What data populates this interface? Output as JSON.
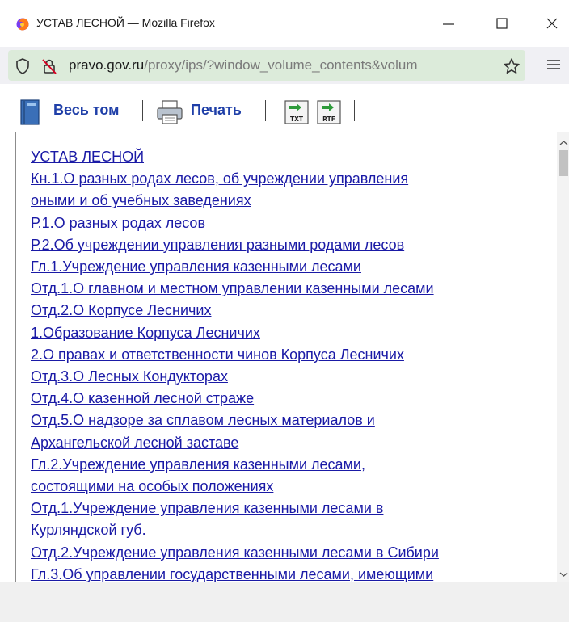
{
  "window": {
    "title": "УСТАВ ЛЕСНОЙ — Mozilla Firefox",
    "icon": "firefox-logo-icon"
  },
  "address_bar": {
    "host": "pravo.gov.ru",
    "path": "/proxy/ips/?window_volume_contents&volum",
    "icons": [
      "shield-icon",
      "connection-not-secure-icon",
      "bookmark-star-icon",
      "hamburger-menu-icon"
    ]
  },
  "page_toolbar": {
    "whole_volume_label": "Весь том",
    "print_label": "Печать",
    "txt_label": "TXT",
    "rtf_label": "RTF"
  },
  "contents_links": [
    "УСТАВ ЛЕСНОЙ",
    "Кн.1.О разных родах лесов, об учреждении управления",
    "оными и об учебных заведениях",
    "Р.1.О разных родах лесов",
    "Р.2.Об учреждении управления разными родами лесов",
    "Гл.1.Учреждение управления казенными лесами",
    "Отд.1.О главном и местном управлении казенными лесами",
    "Отд.2.О Корпусе Лесничих",
    "1.Образование Корпуса Лесничих",
    "2.О правах и ответственности чинов Корпуса Лесничих",
    "Отд.3.О Лесных Кондукторах",
    "Отд.4.О казенной лесной страже",
    "Отд.5.О надзоре за сплавом лесных материалов и",
    "Архангельской лесной заставе",
    "Гл.2.Учреждение управления казенными лесами,",
    "состоящими на особых положениях",
    "Отд.1.Учреждение управления казенными лесами в",
    "Курляндской губ.",
    "Отд.2.Учреждение управления казенными лесами в Сибири",
    "Гл.3.Об управлении государственными лесами, имеющими"
  ],
  "colors": {
    "link": "#1a1aa6",
    "toolbar_text": "#1f3fa8",
    "urlbar_bg": "#dcebda"
  }
}
